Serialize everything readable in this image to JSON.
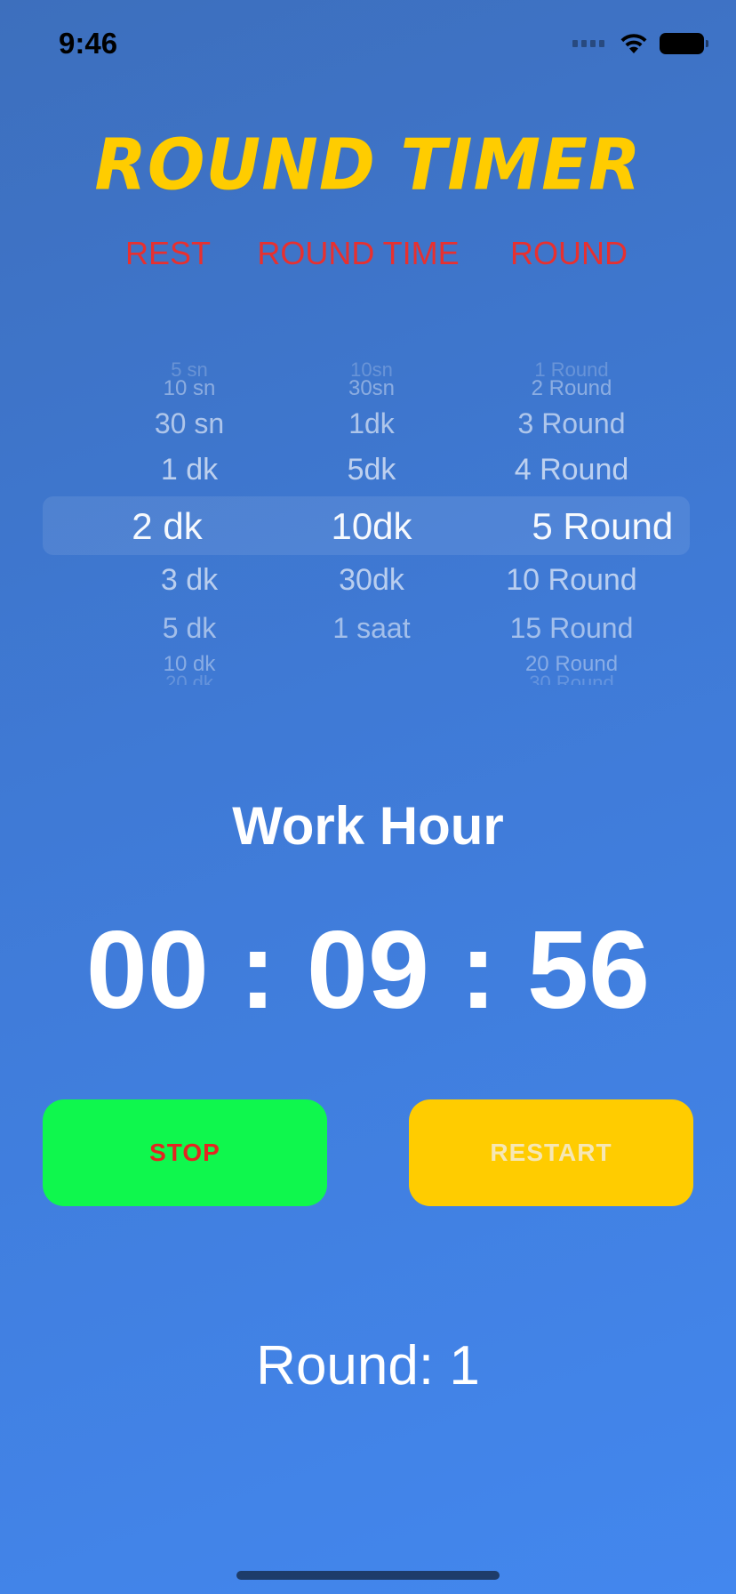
{
  "status_bar": {
    "time": "9:46",
    "icons": [
      "cellular-signal-icon",
      "wifi-icon",
      "battery-icon"
    ]
  },
  "app": {
    "title": "ROUND TIMER",
    "title_color": "#ffcc00"
  },
  "picker_labels": {
    "rest": "REST",
    "round_time": "ROUND TIME",
    "round": "ROUND",
    "color": "#e8302f"
  },
  "picker": {
    "rest": {
      "items": [
        "5 sn",
        "10 sn",
        "30 sn",
        "1 dk",
        "2 dk",
        "3 dk",
        "5 dk",
        "10 dk",
        "20 dk"
      ],
      "selected": "2 dk"
    },
    "round_time": {
      "items": [
        "10sn",
        "30sn",
        "1dk",
        "5dk",
        "10dk",
        "30dk",
        "1 saat",
        "",
        ""
      ],
      "selected": "10dk"
    },
    "round": {
      "items": [
        "1 Round",
        "2 Round",
        "3 Round",
        "4 Round",
        "5 Round",
        "10 Round",
        "15 Round",
        "20 Round",
        "30 Round"
      ],
      "selected": "5 Round"
    }
  },
  "timer": {
    "mode": "Work Hour",
    "display": "00 : 09 : 56"
  },
  "buttons": {
    "stop": "STOP",
    "restart": "RESTART",
    "stop_bg": "#0ff74d",
    "stop_text_color": "#e52421",
    "restart_bg": "#ffcc00"
  },
  "round_status": "Round: 1"
}
